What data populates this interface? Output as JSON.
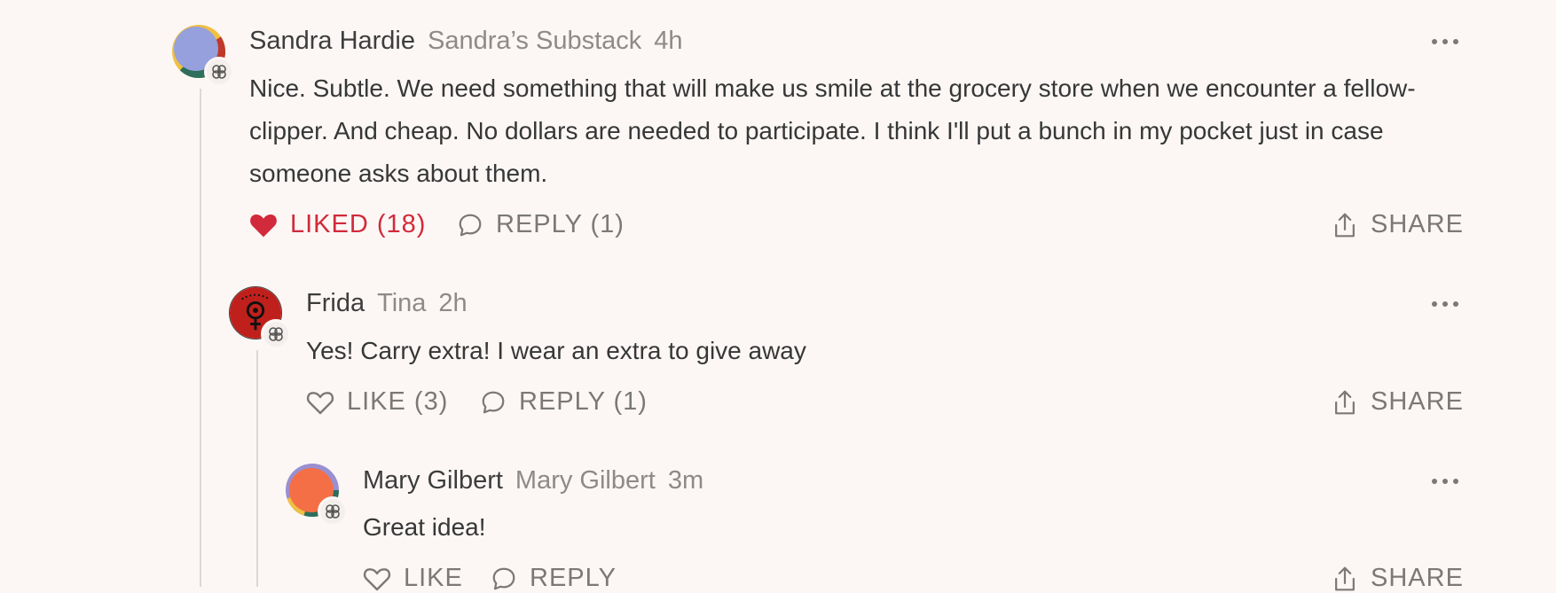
{
  "comments": [
    {
      "author": "Sandra Hardie",
      "publication": "Sandra’s Substack",
      "time": "4h",
      "text": "Nice. Subtle. We need something that will make us smile at the grocery store when we encounter a fellow-clipper. And cheap. No dollars are needed to participate. I think I'll put a bunch in my pocket just in case someone asks about them.",
      "like_label": "LIKED (18)",
      "liked": true,
      "reply_label": "REPLY (1)",
      "share_label": "SHARE"
    },
    {
      "author": "Frida",
      "publication": "Tina",
      "time": "2h",
      "text": "Yes! Carry extra! I wear an extra to give away",
      "like_label": "LIKE (3)",
      "liked": false,
      "reply_label": "REPLY (1)",
      "share_label": "SHARE"
    },
    {
      "author": "Mary Gilbert",
      "publication": "Mary Gilbert",
      "time": "3m",
      "text": "Great idea!",
      "like_label": "LIKE",
      "liked": false,
      "reply_label": "REPLY",
      "share_label": "SHARE"
    }
  ],
  "colors": {
    "background": "#fcf7f5",
    "liked": "#d12a3a",
    "muted": "#8d8a88"
  }
}
